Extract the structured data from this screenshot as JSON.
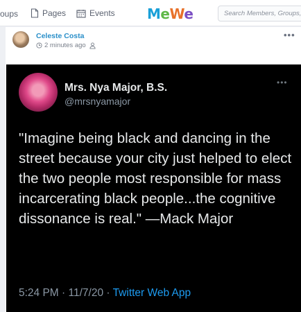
{
  "topbar": {
    "nav": [
      {
        "label": "roups",
        "icon": "groups-icon"
      },
      {
        "label": "Pages",
        "icon": "page-icon"
      },
      {
        "label": "Events",
        "icon": "calendar-icon"
      }
    ],
    "logo": {
      "m": "M",
      "e": "e",
      "w": "W",
      "e2": "e"
    },
    "search_placeholder": "Search Members, Groups, e"
  },
  "post": {
    "author": "Celeste Costa",
    "time": "2 minutes ago",
    "more": "•••"
  },
  "tweet": {
    "name": "Mrs. Nya Major, B.S.",
    "handle": "@mrsnyamajor",
    "more": "•••",
    "text": "\"Imagine being black and dancing in the street because your city just helped to elect the two people most responsible for mass incarcerating black people...the cognitive dissonance is real.\" —Mack Major",
    "timestamp": "5:24 PM · 11/7/20 · ",
    "app": "Twitter Web App"
  },
  "colors": {
    "link": "#2a8fc9",
    "twitter_blue": "#1d9bf0",
    "tweet_bg": "#000000"
  }
}
